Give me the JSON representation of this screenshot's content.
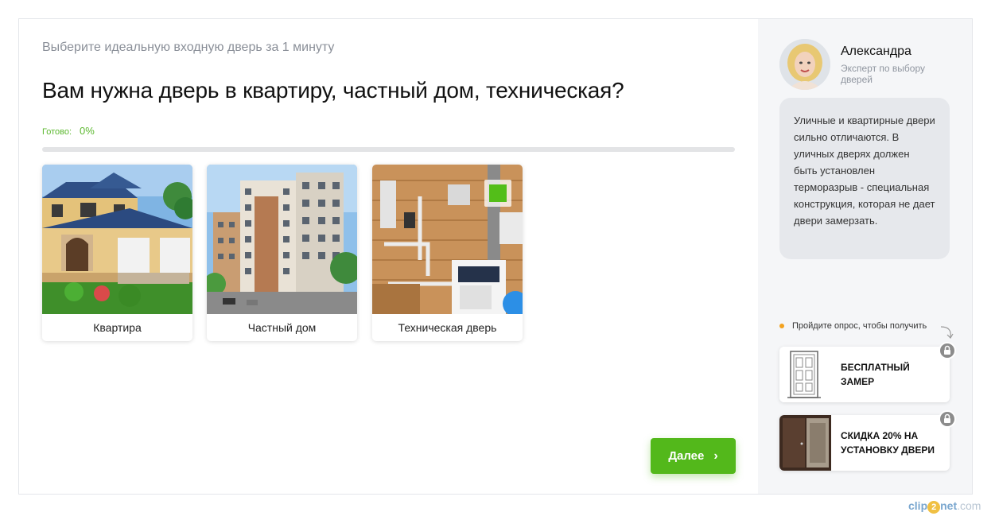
{
  "quiz": {
    "subtitle": "Выберите идеальную входную дверь за 1 минуту",
    "question": "Вам нужна дверь в квартиру, частный дом, техническая?",
    "ready_label": "Готово:",
    "progress_text": "0%",
    "progress_value": 0,
    "options": [
      {
        "label": "Квартира",
        "selected": false
      },
      {
        "label": "Частный дом",
        "selected": false
      },
      {
        "label": "Техническая дверь",
        "selected": true
      }
    ],
    "next_label": "Далее",
    "accent_color": "#53b81b"
  },
  "expert": {
    "name": "Александра",
    "role": "Эксперт по выбору дверей",
    "message": "Уличные и квартирные двери сильно отличаются. В уличных дверях должен быть установлен терморазрыв - специальная конструкция, которая не дает двери замерзать."
  },
  "bonuses": {
    "hint": "Пройдите опрос, чтобы получить",
    "items": [
      {
        "label": "БЕСПЛАТНЫЙ ЗАМЕР"
      },
      {
        "label": "СКИДКА 20% НА УСТАНОВКУ ДВЕРИ"
      }
    ]
  },
  "watermark": {
    "left": "clip",
    "middle": "2",
    "right": "net",
    "suffix": ".com"
  }
}
